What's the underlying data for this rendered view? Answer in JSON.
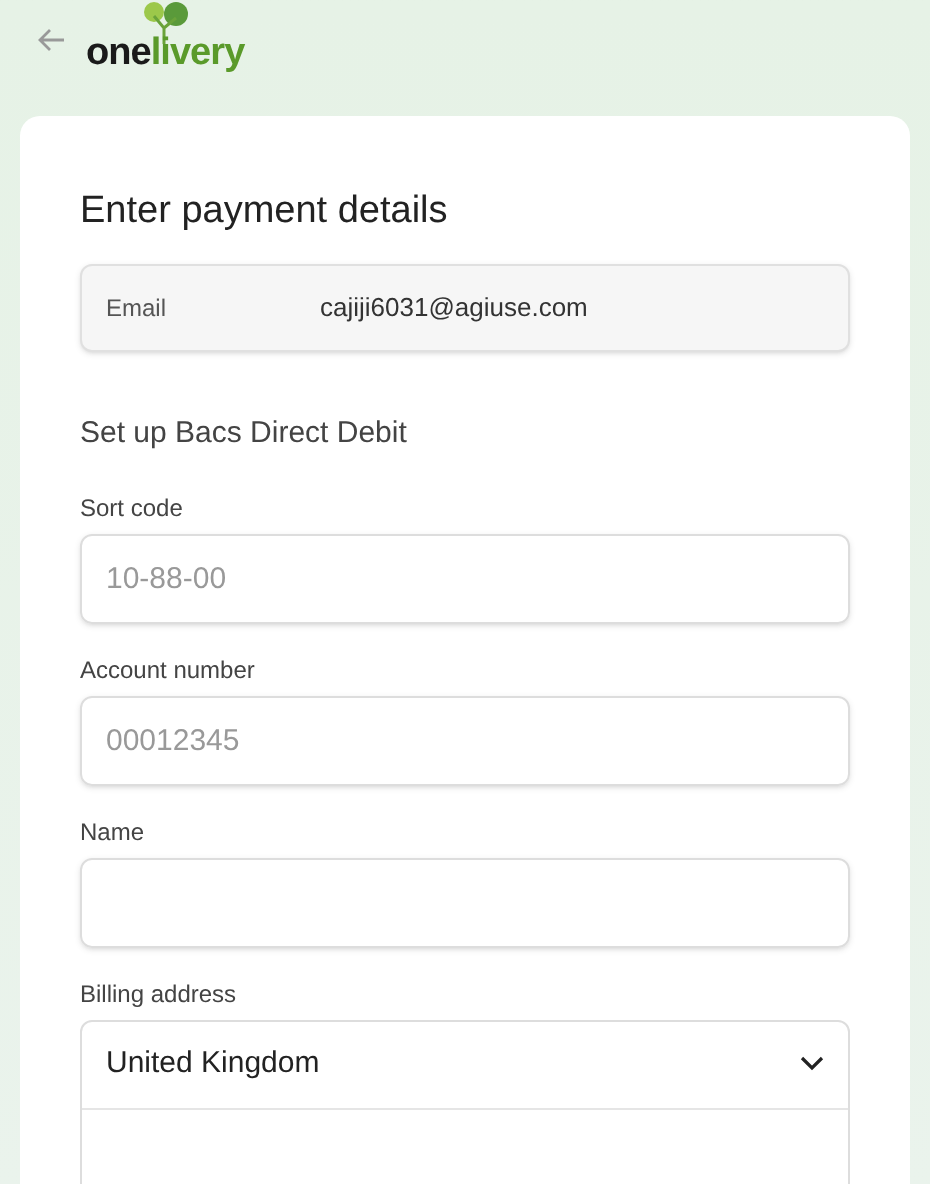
{
  "header": {
    "logo": {
      "first": "one",
      "second": "livery"
    }
  },
  "form": {
    "title": "Enter payment details",
    "email": {
      "label": "Email",
      "value": "cajiji6031@agiuse.com"
    },
    "section_title": "Set up Bacs Direct Debit",
    "fields": [
      {
        "label": "Sort code",
        "placeholder": "10-88-00"
      },
      {
        "label": "Account number",
        "placeholder": "00012345"
      },
      {
        "label": "Name"
      }
    ],
    "billing": {
      "label": "Billing address",
      "country": "United Kingdom"
    }
  }
}
